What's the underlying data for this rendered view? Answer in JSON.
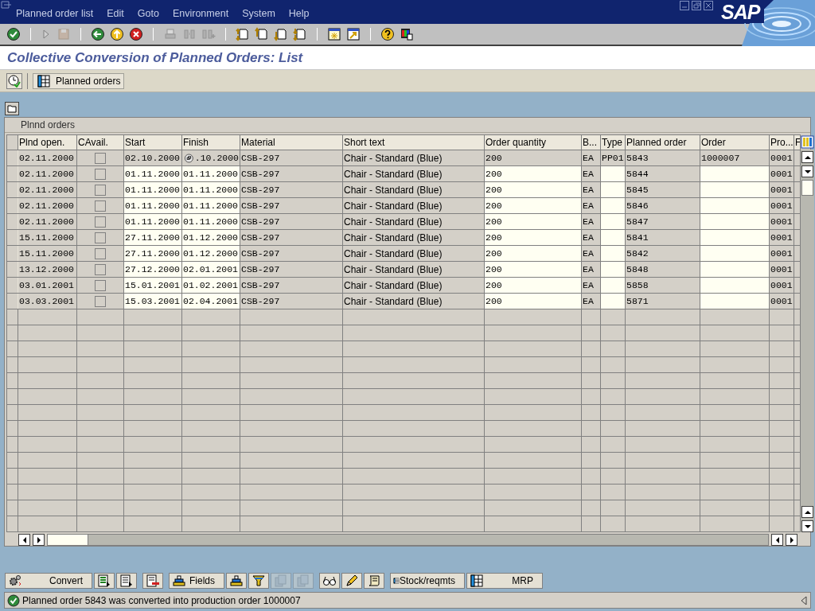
{
  "menu": [
    "Planned order list",
    "Edit",
    "Goto",
    "Environment",
    "System",
    "Help"
  ],
  "logo": "SAP",
  "toolbar": [
    {
      "kind": "enter",
      "disabled": false
    },
    {
      "kind": "separator"
    },
    {
      "kind": "expand",
      "disabled": false
    },
    {
      "kind": "save",
      "disabled": true
    },
    {
      "kind": "separator"
    },
    {
      "kind": "back",
      "disabled": false
    },
    {
      "kind": "exit",
      "disabled": false
    },
    {
      "kind": "cancel",
      "disabled": false
    },
    {
      "kind": "separator"
    },
    {
      "kind": "print",
      "disabled": true
    },
    {
      "kind": "find",
      "disabled": true
    },
    {
      "kind": "find-next",
      "disabled": true
    },
    {
      "kind": "separator"
    },
    {
      "kind": "first-page",
      "disabled": false
    },
    {
      "kind": "previous-page",
      "disabled": false
    },
    {
      "kind": "next-page",
      "disabled": false
    },
    {
      "kind": "last-page",
      "disabled": false
    },
    {
      "kind": "separator"
    },
    {
      "kind": "new-session",
      "disabled": false
    },
    {
      "kind": "shortcut",
      "disabled": false
    },
    {
      "kind": "separator"
    },
    {
      "kind": "help",
      "disabled": false
    },
    {
      "kind": "layout",
      "disabled": false
    }
  ],
  "title": "Collective Conversion of Planned Orders: List",
  "app_toolbar": {
    "planned_orders_button": "Planned orders"
  },
  "table": {
    "title": "Plnnd orders",
    "columns": [
      "Plnd open.",
      "CAvail.",
      "Start",
      "Finish",
      "Material",
      "Short text",
      "Order quantity",
      "B...",
      "Type",
      "Planned order",
      "Order",
      "Pro...",
      "F"
    ],
    "rows": [
      {
        "converted": true,
        "plnd_open": "02.11.2000",
        "checked": false,
        "start": "02.10.2000",
        "finish": ".10.2000",
        "finish_icon": true,
        "material": "CSB-297",
        "short_text": "Chair - Standard (Blue)",
        "quantity": "200",
        "unit": "EA",
        "type": "PP01",
        "planned_order": "5843",
        "order": "1000007",
        "pro": "0001"
      },
      {
        "converted": false,
        "plnd_open": "02.11.2000",
        "checked": false,
        "start": "01.11.2000",
        "finish": "01.11.2000",
        "finish_icon": false,
        "material": "CSB-297",
        "short_text": "Chair - Standard (Blue)",
        "quantity": "200",
        "unit": "EA",
        "type": "",
        "planned_order": "5844",
        "order": "",
        "pro": "0001"
      },
      {
        "converted": false,
        "plnd_open": "02.11.2000",
        "checked": false,
        "start": "01.11.2000",
        "finish": "01.11.2000",
        "finish_icon": false,
        "material": "CSB-297",
        "short_text": "Chair - Standard (Blue)",
        "quantity": "200",
        "unit": "EA",
        "type": "",
        "planned_order": "5845",
        "order": "",
        "pro": "0001"
      },
      {
        "converted": false,
        "plnd_open": "02.11.2000",
        "checked": false,
        "start": "01.11.2000",
        "finish": "01.11.2000",
        "finish_icon": false,
        "material": "CSB-297",
        "short_text": "Chair - Standard (Blue)",
        "quantity": "200",
        "unit": "EA",
        "type": "",
        "planned_order": "5846",
        "order": "",
        "pro": "0001"
      },
      {
        "converted": false,
        "plnd_open": "02.11.2000",
        "checked": false,
        "start": "01.11.2000",
        "finish": "01.11.2000",
        "finish_icon": false,
        "material": "CSB-297",
        "short_text": "Chair - Standard (Blue)",
        "quantity": "200",
        "unit": "EA",
        "type": "",
        "planned_order": "5847",
        "order": "",
        "pro": "0001"
      },
      {
        "converted": false,
        "plnd_open": "15.11.2000",
        "checked": false,
        "start": "27.11.2000",
        "finish": "01.12.2000",
        "finish_icon": false,
        "material": "CSB-297",
        "short_text": "Chair - Standard (Blue)",
        "quantity": "200",
        "unit": "EA",
        "type": "",
        "planned_order": "5841",
        "order": "",
        "pro": "0001"
      },
      {
        "converted": false,
        "plnd_open": "15.11.2000",
        "checked": false,
        "start": "27.11.2000",
        "finish": "01.12.2000",
        "finish_icon": false,
        "material": "CSB-297",
        "short_text": "Chair - Standard (Blue)",
        "quantity": "200",
        "unit": "EA",
        "type": "",
        "planned_order": "5842",
        "order": "",
        "pro": "0001"
      },
      {
        "converted": false,
        "plnd_open": "13.12.2000",
        "checked": false,
        "start": "27.12.2000",
        "finish": "02.01.2001",
        "finish_icon": false,
        "material": "CSB-297",
        "short_text": "Chair - Standard (Blue)",
        "quantity": "200",
        "unit": "EA",
        "type": "",
        "planned_order": "5848",
        "order": "",
        "pro": "0001"
      },
      {
        "converted": false,
        "plnd_open": "03.01.2001",
        "checked": false,
        "start": "15.01.2001",
        "finish": "01.02.2001",
        "finish_icon": false,
        "material": "CSB-297",
        "short_text": "Chair - Standard (Blue)",
        "quantity": "200",
        "unit": "EA",
        "type": "",
        "planned_order": "5858",
        "order": "",
        "pro": "0001"
      },
      {
        "converted": false,
        "plnd_open": "03.03.2001",
        "checked": false,
        "start": "15.03.2001",
        "finish": "02.04.2001",
        "finish_icon": false,
        "material": "CSB-297",
        "short_text": "Chair - Standard (Blue)",
        "quantity": "200",
        "unit": "EA",
        "type": "",
        "planned_order": "5871",
        "order": "",
        "pro": "0001"
      }
    ]
  },
  "bottom_buttons": [
    {
      "kind": "convert",
      "label": "Convert",
      "disabled": false
    },
    {
      "kind": "select-all",
      "disabled": false
    },
    {
      "kind": "select-block",
      "disabled": false
    },
    {
      "kind": "deselect",
      "disabled": false
    },
    {
      "kind": "fields",
      "label": "Fields",
      "disabled": false
    },
    {
      "kind": "sort",
      "disabled": false
    },
    {
      "kind": "filter",
      "disabled": false
    },
    {
      "kind": "copy-up",
      "disabled": true
    },
    {
      "kind": "copy-down",
      "disabled": true
    },
    {
      "kind": "display",
      "disabled": false
    },
    {
      "kind": "change",
      "disabled": false
    },
    {
      "kind": "log",
      "disabled": false
    },
    {
      "kind": "stock",
      "label": "Stock/reqmts",
      "disabled": false
    },
    {
      "kind": "mrp",
      "label": "MRP",
      "disabled": false
    }
  ],
  "status_bar": {
    "kind": "success",
    "message": "Planned order 5843 was converted into production order 1000007"
  }
}
